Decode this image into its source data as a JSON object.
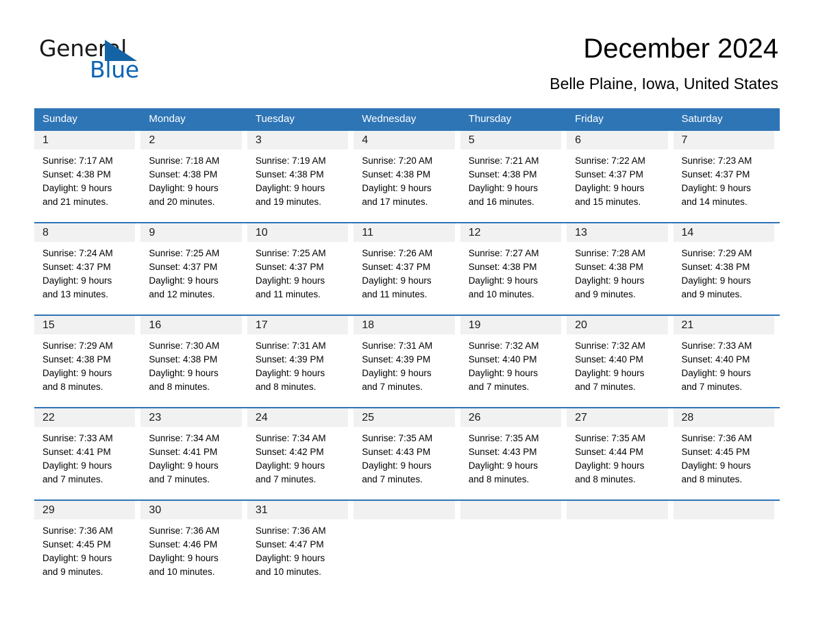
{
  "logo": {
    "word_general": "General",
    "word_blue": "Blue",
    "triangle_color": "#1464a5",
    "blue_color": "#0a64b4"
  },
  "header": {
    "title": "December 2024",
    "subtitle": "Belle Plaine, Iowa, United States",
    "accent_color": "#2e75b6",
    "day_band_color": "#f1f1f1"
  },
  "weekdays": [
    "Sunday",
    "Monday",
    "Tuesday",
    "Wednesday",
    "Thursday",
    "Friday",
    "Saturday"
  ],
  "weeks": [
    [
      {
        "day": "1",
        "sunrise": "Sunrise: 7:17 AM",
        "sunset": "Sunset: 4:38 PM",
        "daylight1": "Daylight: 9 hours",
        "daylight2": "and 21 minutes."
      },
      {
        "day": "2",
        "sunrise": "Sunrise: 7:18 AM",
        "sunset": "Sunset: 4:38 PM",
        "daylight1": "Daylight: 9 hours",
        "daylight2": "and 20 minutes."
      },
      {
        "day": "3",
        "sunrise": "Sunrise: 7:19 AM",
        "sunset": "Sunset: 4:38 PM",
        "daylight1": "Daylight: 9 hours",
        "daylight2": "and 19 minutes."
      },
      {
        "day": "4",
        "sunrise": "Sunrise: 7:20 AM",
        "sunset": "Sunset: 4:38 PM",
        "daylight1": "Daylight: 9 hours",
        "daylight2": "and 17 minutes."
      },
      {
        "day": "5",
        "sunrise": "Sunrise: 7:21 AM",
        "sunset": "Sunset: 4:38 PM",
        "daylight1": "Daylight: 9 hours",
        "daylight2": "and 16 minutes."
      },
      {
        "day": "6",
        "sunrise": "Sunrise: 7:22 AM",
        "sunset": "Sunset: 4:37 PM",
        "daylight1": "Daylight: 9 hours",
        "daylight2": "and 15 minutes."
      },
      {
        "day": "7",
        "sunrise": "Sunrise: 7:23 AM",
        "sunset": "Sunset: 4:37 PM",
        "daylight1": "Daylight: 9 hours",
        "daylight2": "and 14 minutes."
      }
    ],
    [
      {
        "day": "8",
        "sunrise": "Sunrise: 7:24 AM",
        "sunset": "Sunset: 4:37 PM",
        "daylight1": "Daylight: 9 hours",
        "daylight2": "and 13 minutes."
      },
      {
        "day": "9",
        "sunrise": "Sunrise: 7:25 AM",
        "sunset": "Sunset: 4:37 PM",
        "daylight1": "Daylight: 9 hours",
        "daylight2": "and 12 minutes."
      },
      {
        "day": "10",
        "sunrise": "Sunrise: 7:25 AM",
        "sunset": "Sunset: 4:37 PM",
        "daylight1": "Daylight: 9 hours",
        "daylight2": "and 11 minutes."
      },
      {
        "day": "11",
        "sunrise": "Sunrise: 7:26 AM",
        "sunset": "Sunset: 4:37 PM",
        "daylight1": "Daylight: 9 hours",
        "daylight2": "and 11 minutes."
      },
      {
        "day": "12",
        "sunrise": "Sunrise: 7:27 AM",
        "sunset": "Sunset: 4:38 PM",
        "daylight1": "Daylight: 9 hours",
        "daylight2": "and 10 minutes."
      },
      {
        "day": "13",
        "sunrise": "Sunrise: 7:28 AM",
        "sunset": "Sunset: 4:38 PM",
        "daylight1": "Daylight: 9 hours",
        "daylight2": "and 9 minutes."
      },
      {
        "day": "14",
        "sunrise": "Sunrise: 7:29 AM",
        "sunset": "Sunset: 4:38 PM",
        "daylight1": "Daylight: 9 hours",
        "daylight2": "and 9 minutes."
      }
    ],
    [
      {
        "day": "15",
        "sunrise": "Sunrise: 7:29 AM",
        "sunset": "Sunset: 4:38 PM",
        "daylight1": "Daylight: 9 hours",
        "daylight2": "and 8 minutes."
      },
      {
        "day": "16",
        "sunrise": "Sunrise: 7:30 AM",
        "sunset": "Sunset: 4:38 PM",
        "daylight1": "Daylight: 9 hours",
        "daylight2": "and 8 minutes."
      },
      {
        "day": "17",
        "sunrise": "Sunrise: 7:31 AM",
        "sunset": "Sunset: 4:39 PM",
        "daylight1": "Daylight: 9 hours",
        "daylight2": "and 8 minutes."
      },
      {
        "day": "18",
        "sunrise": "Sunrise: 7:31 AM",
        "sunset": "Sunset: 4:39 PM",
        "daylight1": "Daylight: 9 hours",
        "daylight2": "and 7 minutes."
      },
      {
        "day": "19",
        "sunrise": "Sunrise: 7:32 AM",
        "sunset": "Sunset: 4:40 PM",
        "daylight1": "Daylight: 9 hours",
        "daylight2": "and 7 minutes."
      },
      {
        "day": "20",
        "sunrise": "Sunrise: 7:32 AM",
        "sunset": "Sunset: 4:40 PM",
        "daylight1": "Daylight: 9 hours",
        "daylight2": "and 7 minutes."
      },
      {
        "day": "21",
        "sunrise": "Sunrise: 7:33 AM",
        "sunset": "Sunset: 4:40 PM",
        "daylight1": "Daylight: 9 hours",
        "daylight2": "and 7 minutes."
      }
    ],
    [
      {
        "day": "22",
        "sunrise": "Sunrise: 7:33 AM",
        "sunset": "Sunset: 4:41 PM",
        "daylight1": "Daylight: 9 hours",
        "daylight2": "and 7 minutes."
      },
      {
        "day": "23",
        "sunrise": "Sunrise: 7:34 AM",
        "sunset": "Sunset: 4:41 PM",
        "daylight1": "Daylight: 9 hours",
        "daylight2": "and 7 minutes."
      },
      {
        "day": "24",
        "sunrise": "Sunrise: 7:34 AM",
        "sunset": "Sunset: 4:42 PM",
        "daylight1": "Daylight: 9 hours",
        "daylight2": "and 7 minutes."
      },
      {
        "day": "25",
        "sunrise": "Sunrise: 7:35 AM",
        "sunset": "Sunset: 4:43 PM",
        "daylight1": "Daylight: 9 hours",
        "daylight2": "and 7 minutes."
      },
      {
        "day": "26",
        "sunrise": "Sunrise: 7:35 AM",
        "sunset": "Sunset: 4:43 PM",
        "daylight1": "Daylight: 9 hours",
        "daylight2": "and 8 minutes."
      },
      {
        "day": "27",
        "sunrise": "Sunrise: 7:35 AM",
        "sunset": "Sunset: 4:44 PM",
        "daylight1": "Daylight: 9 hours",
        "daylight2": "and 8 minutes."
      },
      {
        "day": "28",
        "sunrise": "Sunrise: 7:36 AM",
        "sunset": "Sunset: 4:45 PM",
        "daylight1": "Daylight: 9 hours",
        "daylight2": "and 8 minutes."
      }
    ],
    [
      {
        "day": "29",
        "sunrise": "Sunrise: 7:36 AM",
        "sunset": "Sunset: 4:45 PM",
        "daylight1": "Daylight: 9 hours",
        "daylight2": "and 9 minutes."
      },
      {
        "day": "30",
        "sunrise": "Sunrise: 7:36 AM",
        "sunset": "Sunset: 4:46 PM",
        "daylight1": "Daylight: 9 hours",
        "daylight2": "and 10 minutes."
      },
      {
        "day": "31",
        "sunrise": "Sunrise: 7:36 AM",
        "sunset": "Sunset: 4:47 PM",
        "daylight1": "Daylight: 9 hours",
        "daylight2": "and 10 minutes."
      },
      {
        "day": "",
        "sunrise": "",
        "sunset": "",
        "daylight1": "",
        "daylight2": ""
      },
      {
        "day": "",
        "sunrise": "",
        "sunset": "",
        "daylight1": "",
        "daylight2": ""
      },
      {
        "day": "",
        "sunrise": "",
        "sunset": "",
        "daylight1": "",
        "daylight2": ""
      },
      {
        "day": "",
        "sunrise": "",
        "sunset": "",
        "daylight1": "",
        "daylight2": ""
      }
    ]
  ]
}
